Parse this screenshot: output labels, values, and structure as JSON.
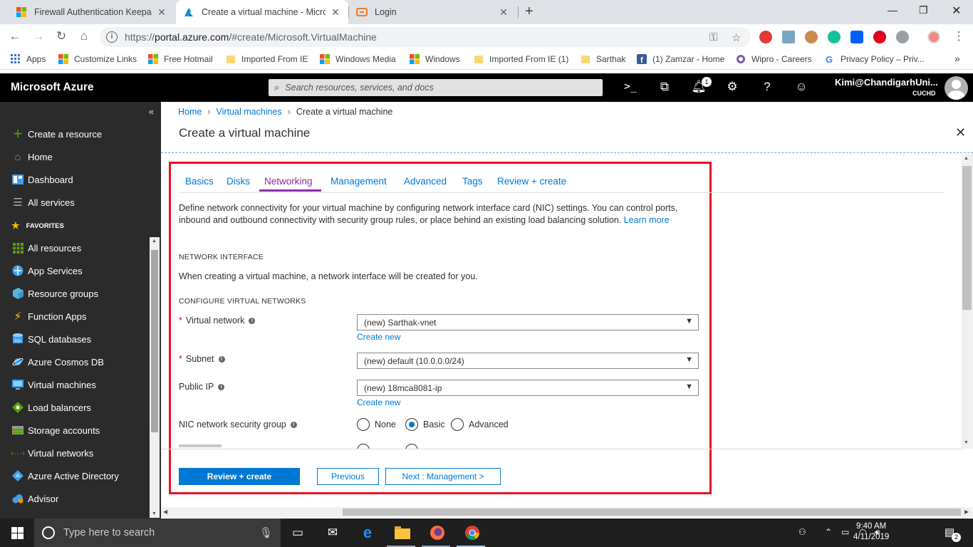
{
  "browser": {
    "tabs": [
      {
        "title": "Firewall Authentication Keepalive",
        "active": false
      },
      {
        "title": "Create a virtual machine - Micros",
        "active": true
      },
      {
        "title": "Login",
        "active": false
      }
    ],
    "url_prefix": "https://",
    "url_host": "portal.azure.com",
    "url_path": "/#create/Microsoft.VirtualMachine",
    "bookmarks": [
      {
        "label": "Apps",
        "icon": "apps-grid-icon"
      },
      {
        "label": "Customize Links",
        "icon": "windows-logo-icon"
      },
      {
        "label": "Free Hotmail",
        "icon": "windows-logo-icon"
      },
      {
        "label": "Imported From IE",
        "icon": "folder-icon"
      },
      {
        "label": "Windows Media",
        "icon": "windows-logo-icon"
      },
      {
        "label": "Windows",
        "icon": "windows-logo-icon"
      },
      {
        "label": "Imported From IE (1)",
        "icon": "folder-icon"
      },
      {
        "label": "Sarthak",
        "icon": "folder-icon"
      },
      {
        "label": "(1) Zamzar - Home",
        "icon": "facebook-icon"
      },
      {
        "label": "Wipro - Careers",
        "icon": "wipro-icon"
      },
      {
        "label": "Privacy Policy – Priv...",
        "icon": "google-icon"
      }
    ]
  },
  "azure": {
    "brand": "Microsoft Azure",
    "search_placeholder": "Search resources, services, and docs",
    "notification_count": "1",
    "user": "Kimi@ChandigarhUni...",
    "tenant": "CUCHD"
  },
  "sidebar": {
    "top_items": [
      {
        "label": "Create a resource",
        "icon": "plus-icon"
      },
      {
        "label": "Home",
        "icon": "home-icon"
      },
      {
        "label": "Dashboard",
        "icon": "dashboard-icon"
      },
      {
        "label": "All services",
        "icon": "list-icon"
      }
    ],
    "favorites_label": "FAVORITES",
    "favorites": [
      {
        "label": "All resources",
        "icon": "grid-icon"
      },
      {
        "label": "App Services",
        "icon": "globe-icon"
      },
      {
        "label": "Resource groups",
        "icon": "cube-icon"
      },
      {
        "label": "Function Apps",
        "icon": "lightning-icon"
      },
      {
        "label": "SQL databases",
        "icon": "sql-icon"
      },
      {
        "label": "Azure Cosmos DB",
        "icon": "planet-icon"
      },
      {
        "label": "Virtual machines",
        "icon": "monitor-icon"
      },
      {
        "label": "Load balancers",
        "icon": "diamond-icon"
      },
      {
        "label": "Storage accounts",
        "icon": "storage-icon"
      },
      {
        "label": "Virtual networks",
        "icon": "network-icon"
      },
      {
        "label": "Azure Active Directory",
        "icon": "pyramid-icon"
      },
      {
        "label": "Advisor",
        "icon": "cloud-icon"
      }
    ]
  },
  "breadcrumb": [
    "Home",
    "Virtual machines",
    "Create a virtual machine"
  ],
  "page_title": "Create a virtual machine",
  "form_tabs": [
    "Basics",
    "Disks",
    "Networking",
    "Management",
    "Advanced",
    "Tags",
    "Review + create"
  ],
  "selected_tab": "Networking",
  "description": "Define network connectivity for your virtual machine by configuring network interface card (NIC) settings. You can control ports, inbound and outbound connectivity with security group rules, or place behind an existing load balancing solution.",
  "learn_more": "Learn more",
  "network_interface": {
    "heading": "NETWORK INTERFACE",
    "note": "When creating a virtual machine, a network interface will be created for you."
  },
  "configure_heading": "CONFIGURE VIRTUAL NETWORKS",
  "fields": {
    "vnet": {
      "label": "Virtual network",
      "value": "(new) Sarthak-vnet",
      "create_new": "Create new"
    },
    "subnet": {
      "label": "Subnet",
      "value": "(new) default (10.0.0.0/24)"
    },
    "public_ip": {
      "label": "Public IP",
      "value": "(new) 18mca8081-ip",
      "create_new": "Create new"
    },
    "nsg": {
      "label": "NIC network security group",
      "options": [
        "None",
        "Basic",
        "Advanced"
      ],
      "selected": "Basic"
    }
  },
  "buttons": {
    "review": "Review + create",
    "previous": "Previous",
    "next": "Next : Management >"
  },
  "taskbar": {
    "search_placeholder": "Type here to search",
    "time": "9:40 AM",
    "date": "4/11/2019",
    "notifications": "2"
  },
  "colors": {
    "azure_blue": "#0078d4",
    "selected_tab": "#8a2da5",
    "highlight_box": "#e81123",
    "sidebar_bg": "#2b2b2b"
  }
}
